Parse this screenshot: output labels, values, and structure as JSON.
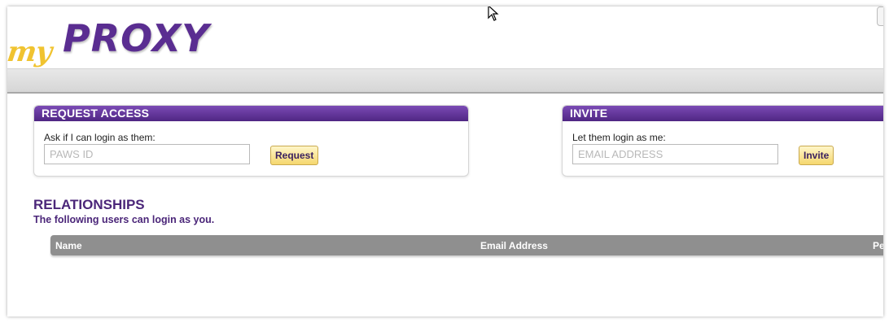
{
  "logo": {
    "my": "my",
    "proxy": "PROXY"
  },
  "request_access": {
    "title": "REQUEST ACCESS",
    "label": "Ask if I can login as them:",
    "placeholder": "PAWS ID",
    "value": "",
    "button": "Request"
  },
  "invite": {
    "title": "INVITE",
    "label": "Let them login as me:",
    "placeholder": "EMAIL ADDRESS",
    "value": "",
    "button": "Invite"
  },
  "relationships": {
    "title": "RELATIONSHIPS",
    "subtitle": "The following users can login as you.",
    "columns": [
      "Name",
      "Email Address",
      "Pe"
    ],
    "rows": []
  },
  "colors": {
    "brand_purple": "#5a2d91",
    "brand_gold": "#f0c330",
    "table_header": "#8f8f8f"
  }
}
